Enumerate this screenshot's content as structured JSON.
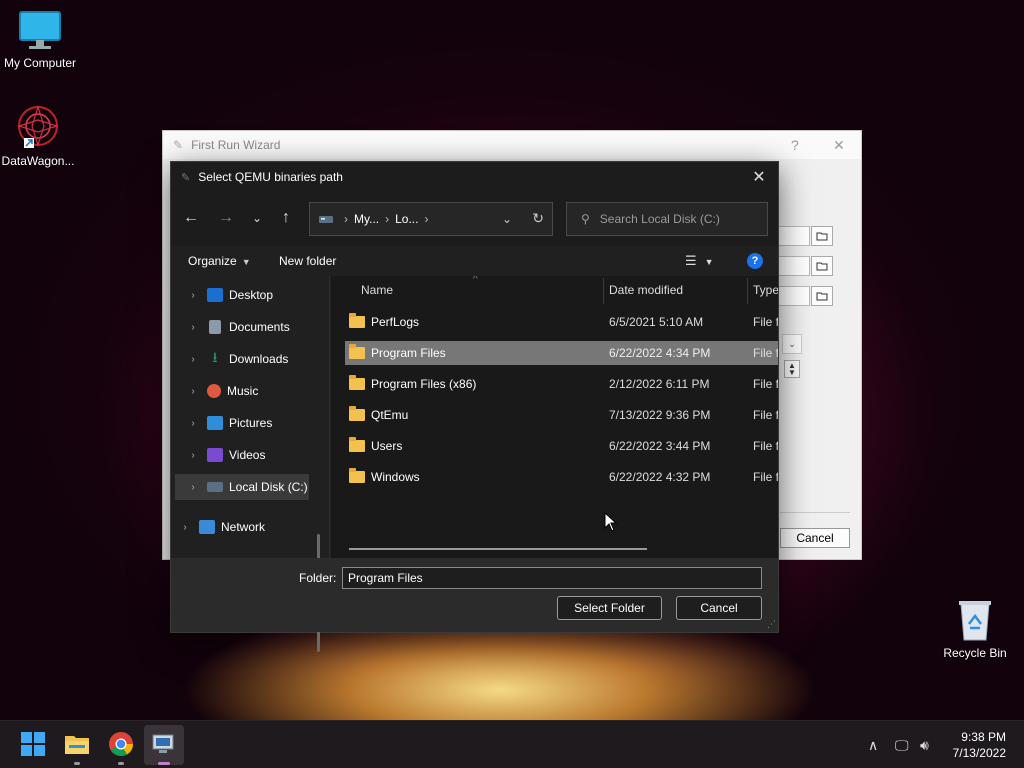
{
  "desktop": {
    "icons": [
      {
        "label": "My Computer",
        "icon": "monitor-icon"
      },
      {
        "label": "DataWagon...",
        "icon": "datawagon-shortcut-icon"
      },
      {
        "label": "Recycle Bin",
        "icon": "recycle-bin-icon"
      }
    ]
  },
  "wizard": {
    "title": "First Run Wizard",
    "help": "?",
    "close": "✕",
    "cancel_label": "Cancel"
  },
  "dialog": {
    "title": "Select QEMU binaries path",
    "address": {
      "crumb1": "My...",
      "crumb2": "Lo..."
    },
    "search_placeholder": "Search Local Disk (C:)",
    "organize_label": "Organize",
    "new_folder_label": "New folder",
    "nav_items": [
      {
        "label": "Desktop",
        "icon": "desktop-icon",
        "color": "#1c6fd1"
      },
      {
        "label": "Documents",
        "icon": "documents-icon",
        "color": "#8a9aa8"
      },
      {
        "label": "Downloads",
        "icon": "downloads-icon",
        "color": "#29a36a"
      },
      {
        "label": "Music",
        "icon": "music-icon",
        "color": "#e0593e"
      },
      {
        "label": "Pictures",
        "icon": "pictures-icon",
        "color": "#2e8fd8"
      },
      {
        "label": "Videos",
        "icon": "videos-icon",
        "color": "#7a4bd0"
      },
      {
        "label": "Local Disk (C:)",
        "icon": "drive-icon",
        "color": "#5a6e85"
      },
      {
        "label": "Network",
        "icon": "network-icon",
        "color": "#3a8ad8"
      }
    ],
    "columns": {
      "name": "Name",
      "date": "Date modified",
      "type": "Type"
    },
    "files": [
      {
        "name": "PerfLogs",
        "date": "6/5/2021 5:10 AM",
        "type": "File fo"
      },
      {
        "name": "Program Files",
        "date": "6/22/2022 4:34 PM",
        "type": "File fo"
      },
      {
        "name": "Program Files (x86)",
        "date": "2/12/2022 6:11 PM",
        "type": "File fo"
      },
      {
        "name": "QtEmu",
        "date": "7/13/2022 9:36 PM",
        "type": "File fo"
      },
      {
        "name": "Users",
        "date": "6/22/2022 3:44 PM",
        "type": "File fo"
      },
      {
        "name": "Windows",
        "date": "6/22/2022 4:32 PM",
        "type": "File fo"
      }
    ],
    "folder_label": "Folder:",
    "folder_value": "Program Files",
    "select_folder_label": "Select Folder",
    "cancel_label": "Cancel"
  },
  "taskbar": {
    "time": "9:38 PM",
    "date": "7/13/2022"
  },
  "colors": {
    "selection": "#777777",
    "accent": "#1a73e8",
    "folder": "#f2c14e"
  }
}
